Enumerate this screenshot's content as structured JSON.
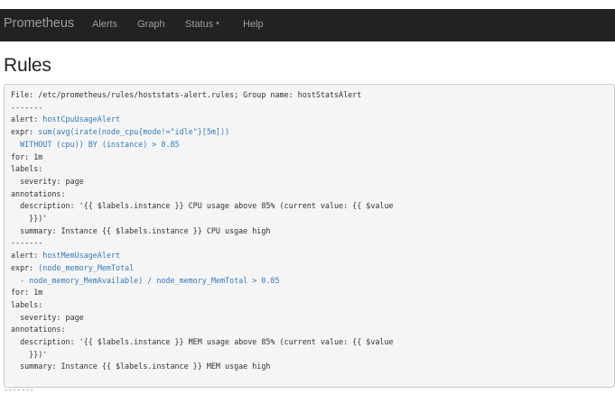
{
  "navbar": {
    "brand": "Prometheus",
    "alerts": "Alerts",
    "graph": "Graph",
    "status": "Status",
    "status_caret": "▾",
    "help": "Help"
  },
  "page": {
    "title": "Rules"
  },
  "rules": {
    "file_line": "File: /etc/prometheus/rules/hoststats-alert.rules; Group name: hostStatsAlert",
    "separator": "-------",
    "alert_key": "alert: ",
    "expr_key": "expr: ",
    "rule1": {
      "alert": "hostCpuUsageAlert",
      "expr_line1": "sum(avg(irate(node_cpu{mode!=\"idle\"}[5m]))",
      "expr_line2": "  WITHOUT (cpu)) BY (instance) > 0.85",
      "for": "for: 1m",
      "labels": "labels:",
      "severity": "  severity: page",
      "annotations": "annotations:",
      "description_line1": "  description: '{{ $labels.instance }} CPU usage above 85% (current value: {{ $value",
      "description_line2": "    }})'",
      "summary": "  summary: Instance {{ $labels.instance }} CPU usgae high"
    },
    "rule2": {
      "alert": "hostMemUsageAlert",
      "expr_line1": "(node_memory_MemTotal",
      "expr_line2": "  - node_memory_MemAvailable) / node_memory_MemTotal > 0.85",
      "for": "for: 1m",
      "labels": "labels:",
      "severity": "  severity: page",
      "annotations": "annotations:",
      "description_line1": "  description: '{{ $labels.instance }} MEM usage above 85% (current value: {{ $value",
      "description_line2": "    }})'",
      "summary": "  summary: Instance {{ $labels.instance }} MEM usgae high"
    }
  },
  "bottom_fragment": "-------"
}
